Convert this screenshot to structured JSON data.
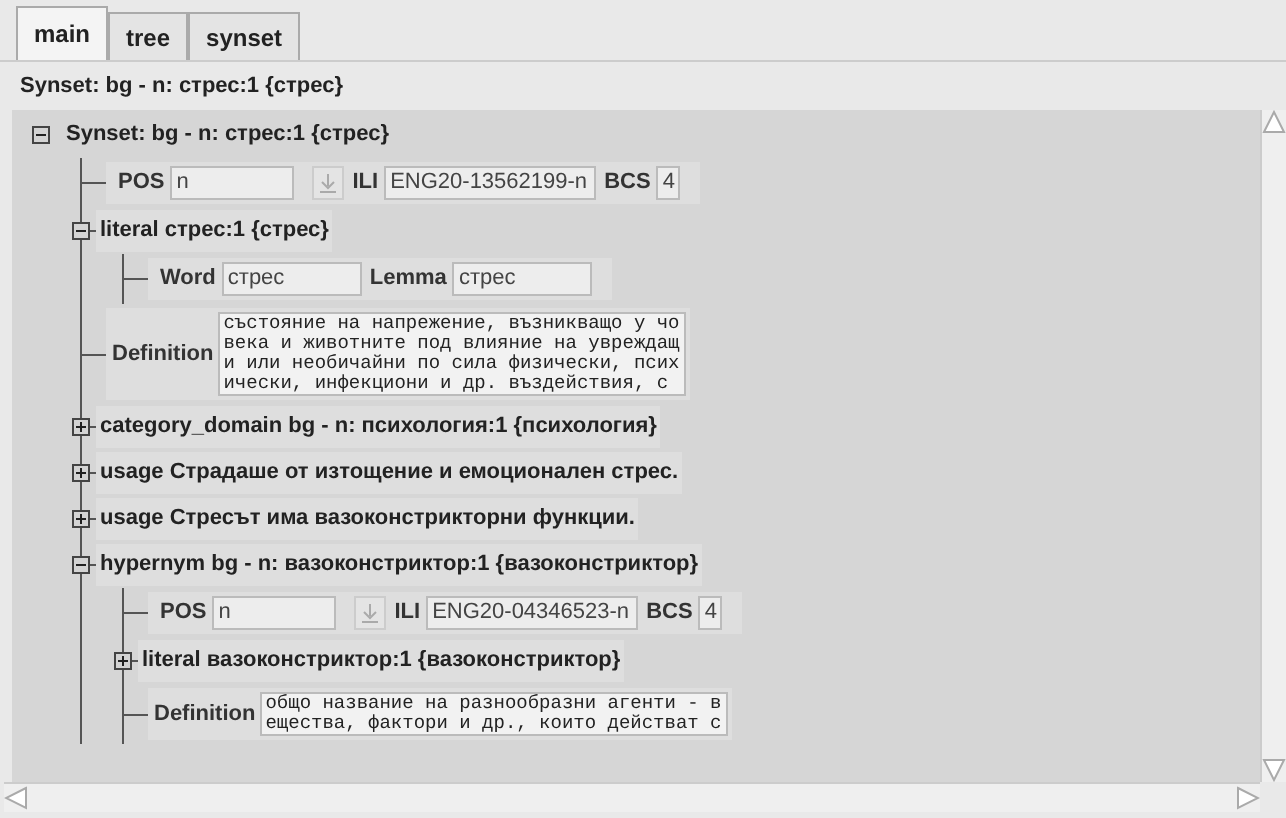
{
  "tabs": [
    {
      "label": "main",
      "selected": true
    },
    {
      "label": "tree",
      "selected": false
    },
    {
      "label": "synset",
      "selected": false
    }
  ],
  "header": "Synset: bg - n: стрес:1 {стрес}",
  "tree": {
    "kind": "node",
    "label": "Synset: bg - n: стрес:1 {стрес}",
    "expanded": true,
    "children": [
      {
        "kind": "fields",
        "fields": [
          {
            "kind": "select",
            "label": "POS",
            "value": "n"
          },
          {
            "kind": "text",
            "label": "ILI",
            "value": "ENG20-13562199-n"
          },
          {
            "kind": "short",
            "label": "BCS",
            "value": "4"
          }
        ]
      },
      {
        "kind": "node",
        "label": "**literal** стрес:1 {стрес}",
        "expanded": true,
        "children": [
          {
            "kind": "fields",
            "fields": [
              {
                "kind": "word",
                "label": "Word",
                "value": "стрес"
              },
              {
                "kind": "word",
                "label": "Lemma",
                "value": "стрес"
              }
            ]
          }
        ]
      },
      {
        "kind": "definition",
        "label": "Definition",
        "lines": [
          "състояние на напрежение, възникващо у чо",
          "века и животните под влияние на увреждащ",
          "и или необичайни по сила физически, псих",
          "ически, инфекциони и др. въздействия, с"
        ]
      },
      {
        "kind": "node",
        "label": "category_domain bg - n: психология:1 {психология}",
        "expanded": false
      },
      {
        "kind": "node",
        "label": "usage Страдаше от изтощение и емоционален стрес.",
        "expanded": false
      },
      {
        "kind": "node",
        "label": "usage Стресът има вазоконстрикторни функции.",
        "expanded": false
      },
      {
        "kind": "node",
        "label": "hypernym bg - n: вазоконстриктор:1 {вазоконстриктор}",
        "expanded": true,
        "children": [
          {
            "kind": "fields",
            "fields": [
              {
                "kind": "select",
                "label": "POS",
                "value": "n"
              },
              {
                "kind": "text",
                "label": "ILI",
                "value": "ENG20-04346523-n"
              },
              {
                "kind": "short",
                "label": "BCS",
                "value": "4"
              }
            ]
          },
          {
            "kind": "node",
            "label": "**literal** вазоконстриктор:1 {вазоконстриктор}",
            "expanded": false
          },
          {
            "kind": "definition",
            "label": "Definition",
            "lines": [
              "общо название на разнообразни агенти - в",
              "ещества, фактори и др., които действат с"
            ]
          }
        ]
      }
    ]
  }
}
